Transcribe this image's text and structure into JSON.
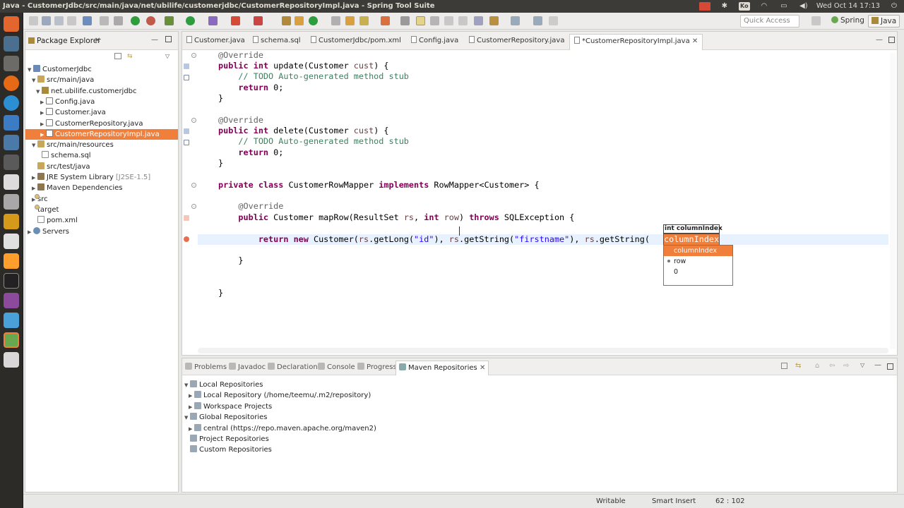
{
  "window": {
    "title": "Java - CustomerJdbc/src/main/java/net/ubilife/customerjdbc/CustomerRepositoryImpl.java - Spring Tool Suite",
    "tray_keyboard": "Ko",
    "clock": "Wed Oct 14 17:13"
  },
  "toolbar": {
    "quick_access_placeholder": "Quick Access",
    "perspectives": [
      "Spring",
      "Java"
    ]
  },
  "package_explorer": {
    "title": "Package Explorer",
    "tree": [
      {
        "label": "CustomerJdbc",
        "depth": 0,
        "icon": "project-icon",
        "expanded": true
      },
      {
        "label": "src/main/java",
        "depth": 1,
        "icon": "source-folder-icon",
        "expanded": true
      },
      {
        "label": "net.ubilife.customerjdbc",
        "depth": 2,
        "icon": "package-icon",
        "expanded": true
      },
      {
        "label": "Config.java",
        "depth": 3,
        "icon": "java-file-icon",
        "expanded": false
      },
      {
        "label": "Customer.java",
        "depth": 3,
        "icon": "java-file-icon",
        "expanded": false
      },
      {
        "label": "CustomerRepository.java",
        "depth": 3,
        "icon": "java-file-icon",
        "expanded": false
      },
      {
        "label": "CustomerRepositoryImpl.java",
        "depth": 3,
        "icon": "java-file-icon",
        "expanded": false,
        "selected": true
      },
      {
        "label": "src/main/resources",
        "depth": 1,
        "icon": "source-folder-icon",
        "expanded": true
      },
      {
        "label": "schema.sql",
        "depth": 2,
        "icon": "file-icon"
      },
      {
        "label": "src/test/java",
        "depth": 1,
        "icon": "source-folder-icon"
      },
      {
        "label": "JRE System Library",
        "suffix": "[J2SE-1.5]",
        "depth": 1,
        "icon": "library-icon",
        "expanded": false
      },
      {
        "label": "Maven Dependencies",
        "depth": 1,
        "icon": "library-icon",
        "expanded": false
      },
      {
        "label": "src",
        "depth": 1,
        "icon": "folder-icon",
        "expanded": false
      },
      {
        "label": "target",
        "depth": 1,
        "icon": "folder-icon"
      },
      {
        "label": "pom.xml",
        "depth": 1,
        "icon": "file-icon"
      },
      {
        "label": "Servers",
        "depth": 0,
        "icon": "servers-icon",
        "expanded": false
      }
    ]
  },
  "editor": {
    "tabs": [
      "Customer.java",
      "schema.sql",
      "CustomerJdbc/pom.xml",
      "Config.java",
      "CustomerRepository.java",
      "*CustomerRepositoryImpl.java"
    ],
    "active_tab": 5,
    "hint": {
      "text": "int columnIndex"
    },
    "suggestions": [
      "columnIndex",
      "row",
      "0"
    ],
    "selected_suggestion": 0,
    "colidx_text": "columnIndex"
  },
  "bottom": {
    "tabs": [
      "Problems",
      "Javadoc",
      "Declaration",
      "Console",
      "Progress",
      "Maven Repositories"
    ],
    "active_tab": 5,
    "tree": [
      {
        "label": "Local Repositories",
        "depth": 0,
        "expanded": true
      },
      {
        "label": "Local Repository (/home/teemu/.m2/repository)",
        "depth": 1,
        "expanded": false
      },
      {
        "label": "Workspace Projects",
        "depth": 1,
        "expanded": false
      },
      {
        "label": "Global Repositories",
        "depth": 0,
        "expanded": true
      },
      {
        "label": "central (https://repo.maven.apache.org/maven2)",
        "depth": 1,
        "expanded": false
      },
      {
        "label": "Project Repositories",
        "depth": 0
      },
      {
        "label": "Custom Repositories",
        "depth": 0
      }
    ]
  },
  "status": {
    "writable": "Writable",
    "insert_mode": "Smart Insert",
    "position": "62 : 102"
  },
  "colors": {
    "selection": "#f07f3c",
    "keyword": "#7f0055",
    "comment": "#3f7f5f",
    "string": "#2a00ff"
  }
}
